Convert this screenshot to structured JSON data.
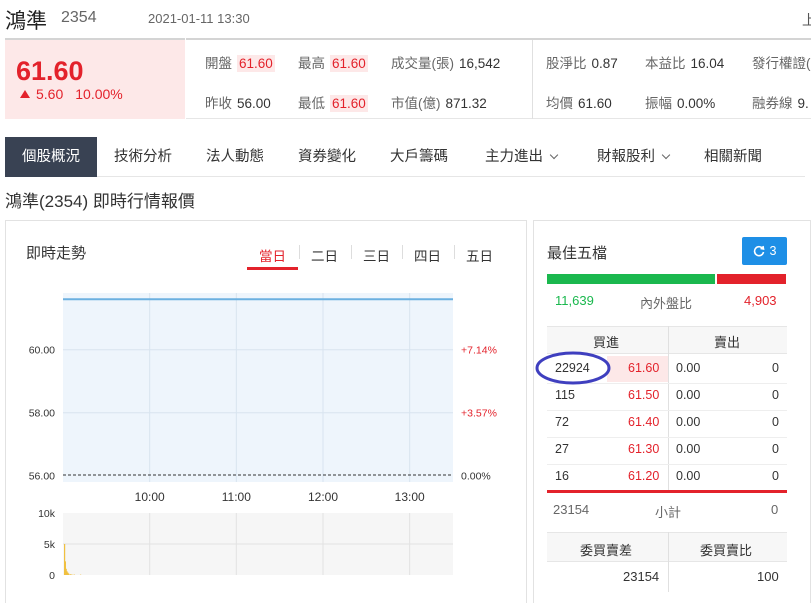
{
  "header": {
    "name": "鴻準",
    "code": "2354",
    "datetime": "2021-01-11 13:30",
    "corner": "上"
  },
  "quote": {
    "price": "61.60",
    "change": "5.60",
    "change_pct": "10.00%"
  },
  "stats": {
    "open": {
      "label": "開盤",
      "value": "61.60"
    },
    "high": {
      "label": "最高",
      "value": "61.60"
    },
    "volume": {
      "label": "成交量(張)",
      "value": "16,542"
    },
    "pb": {
      "label": "股淨比",
      "value": "0.87"
    },
    "pe": {
      "label": "本益比",
      "value": "16.04"
    },
    "warrant": {
      "label": "發行權證(",
      "value": ""
    },
    "prev_close": {
      "label": "昨收",
      "value": "56.00"
    },
    "low": {
      "label": "最低",
      "value": "61.60"
    },
    "mktcap": {
      "label": "市值(億)",
      "value": "871.32"
    },
    "avg": {
      "label": "均價",
      "value": "61.60"
    },
    "amplitude": {
      "label": "振幅",
      "value": "0.00%"
    },
    "margin": {
      "label": "融券線",
      "value": "9."
    }
  },
  "tabs": [
    {
      "label": "個股概況",
      "active": true
    },
    {
      "label": "技術分析"
    },
    {
      "label": "法人動態"
    },
    {
      "label": "資券變化"
    },
    {
      "label": "大戶籌碼"
    },
    {
      "label": "主力進出",
      "dropdown": true
    },
    {
      "label": "財報股利",
      "dropdown": true
    },
    {
      "label": "相關新聞"
    }
  ],
  "section_title": "鴻準(2354) 即時行情報價",
  "trend": {
    "title": "即時走勢",
    "range_tabs": [
      "當日",
      "二日",
      "三日",
      "四日",
      "五日"
    ],
    "active_range": "當日"
  },
  "chart_data": {
    "type": "line",
    "x_ticks": [
      "10:00",
      "11:00",
      "12:00",
      "13:00"
    ],
    "y_ticks": [
      "60.00",
      "58.00",
      "56.00"
    ],
    "pct_ticks": [
      "+7.14%",
      "+3.57%",
      "0.00%"
    ],
    "ylim": [
      55.8,
      61.8
    ],
    "reference_price": 56.0,
    "series": [
      {
        "x": [
          "09:00",
          "13:30"
        ],
        "y": [
          61.6,
          61.6
        ]
      }
    ],
    "volume": {
      "y_ticks": [
        "10k",
        "5k",
        "0"
      ],
      "ylim": [
        0,
        10000
      ],
      "bars": [
        [
          0,
          5000
        ],
        [
          1,
          2200
        ],
        [
          2,
          1000
        ],
        [
          3,
          600
        ],
        [
          4,
          400
        ],
        [
          5,
          250
        ],
        [
          7,
          150
        ],
        [
          9,
          100
        ],
        [
          12,
          80
        ],
        [
          20,
          60
        ]
      ]
    },
    "colors": {
      "line": "#6bb0e0",
      "fill": "#eef5fc",
      "ref": "#333333",
      "volume": "#f0c040",
      "pct": "#e3222b"
    }
  },
  "orderbook": {
    "title": "最佳五檔",
    "refresh_count": "3",
    "inner": "11,639",
    "ratio_label": "內外盤比",
    "outer": "4,903",
    "inner_ratio": 0.704,
    "buy_header": "買進",
    "sell_header": "賣出",
    "rows": [
      {
        "bid_vol": "22924",
        "bid_price": "61.60",
        "ask_price": "0.00",
        "ask_vol": "0"
      },
      {
        "bid_vol": "115",
        "bid_price": "61.50",
        "ask_price": "0.00",
        "ask_vol": "0"
      },
      {
        "bid_vol": "72",
        "bid_price": "61.40",
        "ask_price": "0.00",
        "ask_vol": "0"
      },
      {
        "bid_vol": "27",
        "bid_price": "61.30",
        "ask_price": "0.00",
        "ask_vol": "0"
      },
      {
        "bid_vol": "16",
        "bid_price": "61.20",
        "ask_price": "0.00",
        "ask_vol": "0"
      }
    ],
    "subtotal_bid": "23154",
    "subtotal_label": "小計",
    "subtotal_ask": "0",
    "diff_header": "委買賣差",
    "ratio_header": "委買賣比",
    "diff_value": "23154",
    "ratio_value": "100"
  }
}
